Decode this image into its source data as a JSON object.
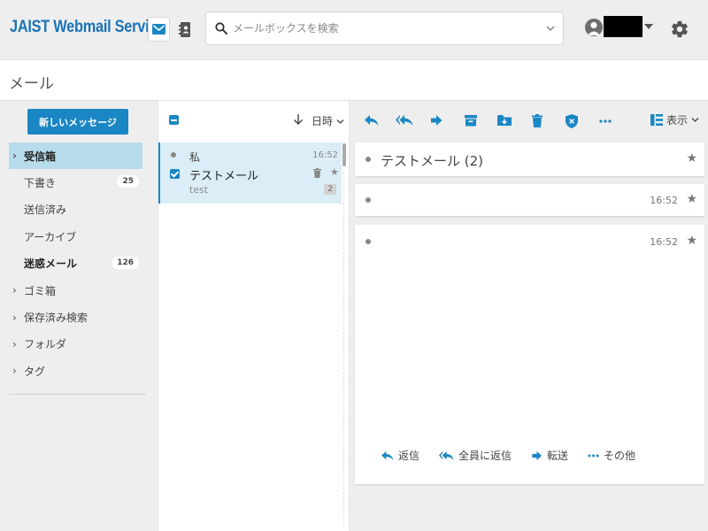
{
  "header": {
    "brand": "JAIST Webmail Service",
    "search_placeholder": "メールボックスを検索",
    "accent_color": "#1b86c4"
  },
  "titlebar": {
    "title": "メール"
  },
  "sidebar": {
    "new_message_label": "新しいメッセージ",
    "folders": [
      {
        "label": "受信箱",
        "expandable": true,
        "active": true,
        "count": ""
      },
      {
        "label": "下書き",
        "expandable": false,
        "active": false,
        "count": "25"
      },
      {
        "label": "送信済み",
        "expandable": false,
        "active": false,
        "count": ""
      },
      {
        "label": "アーカイブ",
        "expandable": false,
        "active": false,
        "count": ""
      },
      {
        "label": "迷惑メール",
        "expandable": false,
        "active": false,
        "count": "126"
      },
      {
        "label": "ゴミ箱",
        "expandable": true,
        "active": false,
        "count": ""
      },
      {
        "label": "保存済み検索",
        "expandable": true,
        "active": false,
        "count": ""
      },
      {
        "label": "フォルダ",
        "expandable": true,
        "active": false,
        "count": ""
      },
      {
        "label": "タグ",
        "expandable": true,
        "active": false,
        "count": ""
      }
    ]
  },
  "message_list": {
    "sort_label": "日時",
    "items": [
      {
        "from": "私",
        "time": "16:52",
        "subject": "テストメール",
        "preview": "test",
        "thread_count": "2",
        "selected": true
      }
    ]
  },
  "reading_pane": {
    "view_label": "表示",
    "thread_title": "テストメール (2)",
    "messages": [
      {
        "time": "16:52"
      },
      {
        "time": "16:52"
      }
    ],
    "actions": {
      "reply": "返信",
      "reply_all": "全員に返信",
      "forward": "転送",
      "more": "その他"
    }
  }
}
